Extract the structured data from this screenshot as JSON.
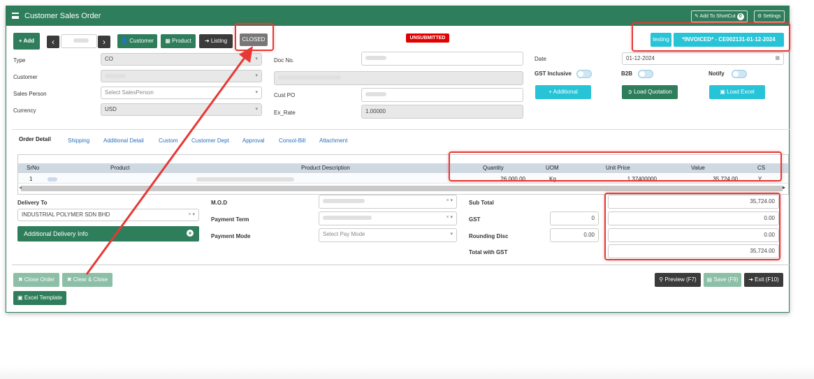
{
  "window": {
    "title": "Customer Sales Order",
    "add_shortcut": "Add To ShortCut",
    "shortcut_count": "0",
    "settings": "Settings"
  },
  "toolbar": {
    "add": "+ Add",
    "prev": "‹",
    "next": "›",
    "customer": "Customer",
    "product": "Product",
    "listing": "Listing",
    "closed": "CLOSED",
    "unsubmitted": "UNSUBMITTED",
    "testing": "testing",
    "invoiced": "*INVOICED* - CE002131-01-12-2024"
  },
  "form": {
    "type_label": "Type",
    "type_value": "CO",
    "customer_label": "Customer",
    "salesperson_label": "Sales Person",
    "salesperson_placeholder": "Select SalesPerson",
    "currency_label": "Currency",
    "currency_value": "USD",
    "docno_label": "Doc No.",
    "custpo_label": "Cust PO",
    "exrate_label": "Ex_Rate",
    "exrate_value": "1.00000",
    "date_label": "Date",
    "date_value": "01-12-2024",
    "gst_inclusive_label": "GST Inclusive",
    "b2b_label": "B2B",
    "notify_label": "Notify",
    "additional_btn": "+ Additional",
    "load_quotation_btn": "Load Quotation",
    "load_excel_btn": "Load Excel"
  },
  "tabs": [
    "Order Detail",
    "Shipping",
    "Additional Detail",
    "Custom",
    "Customer Dept",
    "Approval",
    "Consol-Bill",
    "Attachment"
  ],
  "grid": {
    "headers": [
      "SrNo",
      "Product",
      "Product Description",
      "Quantity",
      "UOM",
      "Unit Price",
      "Value",
      "CS"
    ],
    "rows": [
      {
        "srno": "1",
        "quantity": "26,000.00",
        "uom": "Kg",
        "unit_price": "1.37400000",
        "value": "35,724.00",
        "cs": "Y"
      }
    ],
    "scroll_left": "◂",
    "scroll_right": "▸"
  },
  "delivery": {
    "label": "Delivery To",
    "value": "INDUSTRIAL POLYMER SDN BHD",
    "additional_info": "Additional Delivery Info"
  },
  "payment": {
    "mod_label": "M.O.D",
    "term_label": "Payment Term",
    "mode_label": "Payment Mode",
    "mode_placeholder": "Select Pay Mode"
  },
  "totals": {
    "subtotal_label": "Sub Total",
    "subtotal": "35,724.00",
    "gst_label": "GST",
    "gst_rate": "0",
    "gst": "0.00",
    "rounding_label": "Rounding Disc",
    "rounding_input": "0.00",
    "rounding": "0.00",
    "total_label": "Total with GST",
    "total": "35,724.00"
  },
  "actions": {
    "close_order": "Close Order",
    "clear_close": "Clear & Close",
    "excel_template": "Excel Template",
    "preview": "Preview (F7)",
    "save": "Save (F9)",
    "exit": "Exit (F10)"
  },
  "colors": {
    "brand": "#2e7d5b",
    "accent": "#27c3d6",
    "annotation": "#e53935"
  }
}
